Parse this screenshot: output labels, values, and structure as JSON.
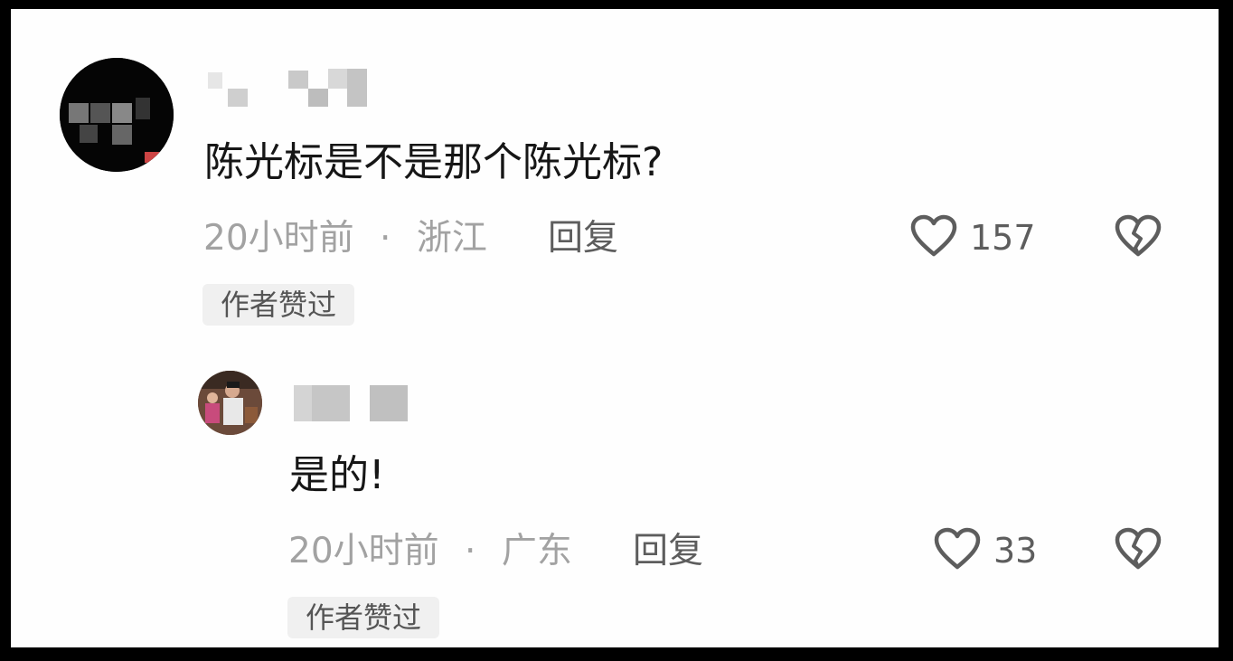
{
  "comment": {
    "text": "陈光标是不是那个陈光标?",
    "time": "20小时前",
    "separator": "·",
    "location": "浙江",
    "reply_label": "回复",
    "likes": "157",
    "badge": "作者赞过"
  },
  "reply": {
    "text": "是的!",
    "time": "20小时前",
    "separator": "·",
    "location": "广东",
    "reply_label": "回复",
    "likes": "33",
    "badge": "作者赞过"
  },
  "icons": {
    "like": "heart-outline-icon",
    "dislike": "broken-heart-icon"
  },
  "colors": {
    "text_primary": "#161616",
    "meta_gray": "#a2a2a2",
    "action_gray": "#5d5d5d",
    "badge_bg": "#f0f0f0"
  }
}
